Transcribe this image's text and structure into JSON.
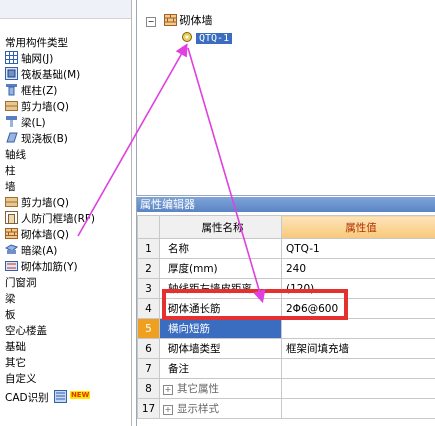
{
  "left_nav": {
    "items": [
      {
        "label": "常用构件类型",
        "icon": "",
        "level": 1
      },
      {
        "label": "轴网(J)",
        "icon": "grid-icon",
        "level": 2
      },
      {
        "label": "筏板基础(M)",
        "icon": "raft-foundation-icon",
        "level": 2
      },
      {
        "label": "框柱(Z)",
        "icon": "column-icon",
        "level": 2
      },
      {
        "label": "剪力墙(Q)",
        "icon": "shear-wall-icon",
        "level": 2
      },
      {
        "label": "梁(L)",
        "icon": "beam-icon",
        "level": 2
      },
      {
        "label": "现浇板(B)",
        "icon": "slab-icon",
        "level": 2
      },
      {
        "label": "轴线",
        "icon": "",
        "level": 1
      },
      {
        "label": "柱",
        "icon": "",
        "level": 1
      },
      {
        "label": "墙",
        "icon": "",
        "level": 1
      },
      {
        "label": "剪力墙(Q)",
        "icon": "shear-wall-icon",
        "level": 2
      },
      {
        "label": "人防门框墙(RF)",
        "icon": "door-frame-wall-icon",
        "level": 2
      },
      {
        "label": "砌体墙(Q)",
        "icon": "masonry-wall-icon",
        "level": 2
      },
      {
        "label": "暗梁(A)",
        "icon": "hidden-beam-icon",
        "level": 2
      },
      {
        "label": "砌体加筋(Y)",
        "icon": "masonry-rebar-icon",
        "level": 2
      },
      {
        "label": "门窗洞",
        "icon": "",
        "level": 1
      },
      {
        "label": "梁",
        "icon": "",
        "level": 1
      },
      {
        "label": "板",
        "icon": "",
        "level": 1
      },
      {
        "label": "空心楼盖",
        "icon": "",
        "level": 1
      },
      {
        "label": "基础",
        "icon": "",
        "level": 1
      },
      {
        "label": "其它",
        "icon": "",
        "level": 1
      },
      {
        "label": "自定义",
        "icon": "",
        "level": 1
      },
      {
        "label": "CAD识别",
        "icon": "cad-icon",
        "level": 1,
        "badge": "NEW"
      }
    ]
  },
  "tree": {
    "root_label": "砌体墙",
    "child_label": "QTQ-1"
  },
  "props": {
    "title": "属性编辑器",
    "col_name": "属性名称",
    "col_value": "属性值",
    "rows": [
      {
        "num": "1",
        "name": "名称",
        "value": "QTQ-1"
      },
      {
        "num": "2",
        "name": "厚度(mm)",
        "value": "240"
      },
      {
        "num": "3",
        "name": "轴线距左墙皮距离",
        "value": "(120)"
      },
      {
        "num": "4",
        "name": "砌体通长筋",
        "value": "2Φ6@600"
      },
      {
        "num": "5",
        "name": "横向短筋",
        "value": ""
      },
      {
        "num": "6",
        "name": "砌体墙类型",
        "value": "框架间填充墙"
      },
      {
        "num": "7",
        "name": "备注",
        "value": ""
      },
      {
        "num": "8",
        "name": "其它属性",
        "value": "",
        "expand": "+"
      },
      {
        "num": "17",
        "name": "显示样式",
        "value": "",
        "expand": "+"
      }
    ]
  },
  "annotation_colors": {
    "arrow": "#e040e0",
    "highlight": "#e53030"
  }
}
